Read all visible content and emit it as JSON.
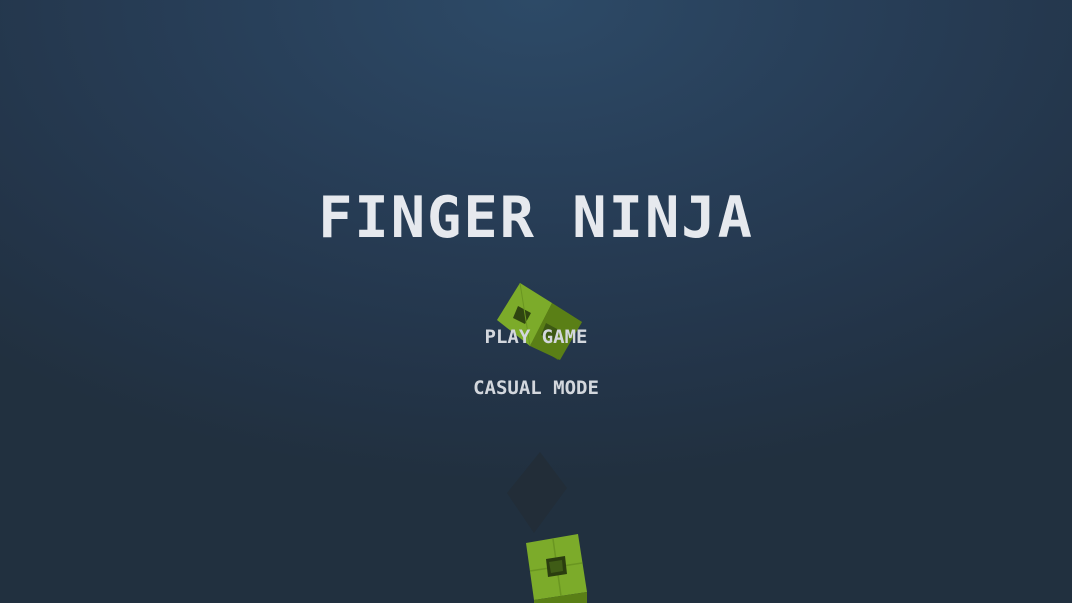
{
  "game": {
    "title": "FINGER NINJA"
  },
  "menu": {
    "items": [
      {
        "label": "PLAY GAME"
      },
      {
        "label": "CASUAL MODE"
      }
    ]
  },
  "colors": {
    "background_top": "#2d4a67",
    "background_bottom": "#21303f",
    "title_text": "#e6e9ee",
    "menu_text": "#d3d7dd",
    "block_green_light": "#7cab2a",
    "block_green_dark": "#5a7f16",
    "shadow_block": "#222d38"
  },
  "objects": {
    "flying_block_icon": "green-cube-icon",
    "shadow_icon": "dark-diamond-icon",
    "bottom_block_icon": "green-cube-icon"
  }
}
